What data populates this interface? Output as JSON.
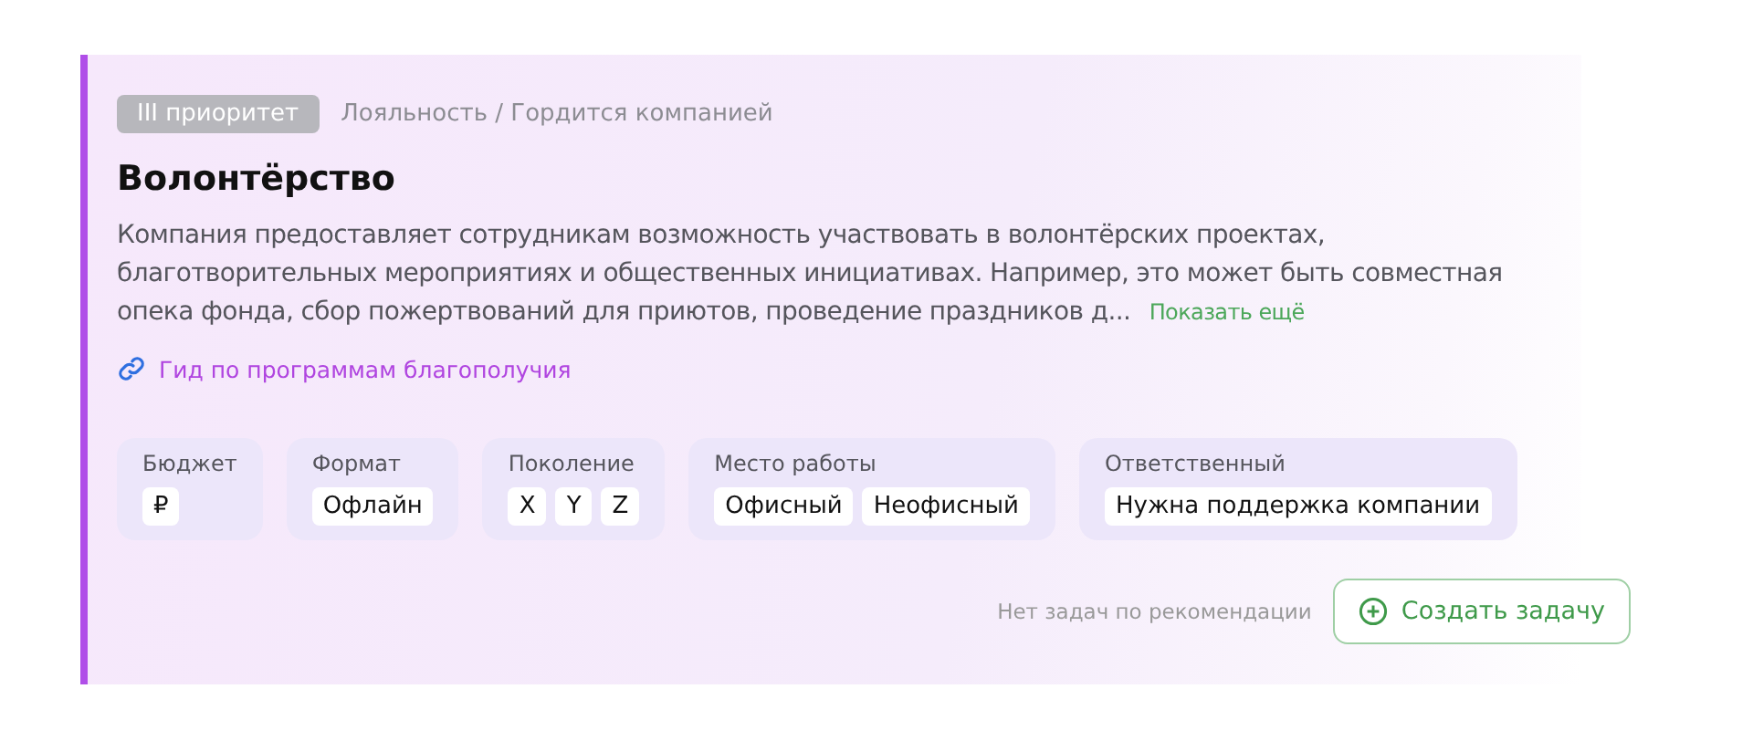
{
  "priority_badge": "III приоритет",
  "breadcrumb": "Лояльность / Гордится компанией",
  "title": "Волонтёрство",
  "description_lines": [
    "Компания предоставляет сотрудникам возможность участвовать в волонтёрских проектах,",
    "благотворительных мероприятиях и общественных инициативах. Например, это может быть совместная",
    "опека фонда, сбор пожертвований для приютов, проведение праздников д..."
  ],
  "show_more": "Показать ещё",
  "guide_link": "Гид по программам благополучия",
  "attributes": [
    {
      "label": "Бюджет",
      "values": [
        "₽"
      ]
    },
    {
      "label": "Формат",
      "values": [
        "Офлайн"
      ]
    },
    {
      "label": "Поколение",
      "values": [
        "X",
        "Y",
        "Z"
      ]
    },
    {
      "label": "Место работы",
      "values": [
        "Офисный",
        "Неофисный"
      ]
    },
    {
      "label": "Ответственный",
      "values": [
        "Нужна поддержка компании"
      ]
    }
  ],
  "no_tasks": "Нет задач по рекомендации",
  "create_button": "Создать задачу"
}
